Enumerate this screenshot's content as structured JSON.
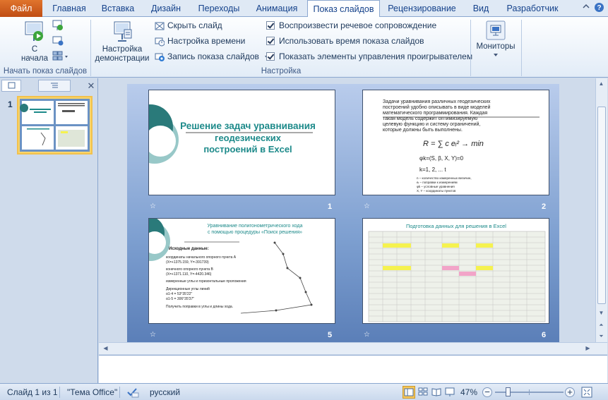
{
  "tabs": [
    "Файл",
    "Главная",
    "Вставка",
    "Дизайн",
    "Переходы",
    "Анимация",
    "Показ слайдов",
    "Рецензирование",
    "Вид",
    "Разработчик"
  ],
  "ribbon": {
    "group1": {
      "from_start_label_line1": "С",
      "from_start_label_line2": "начала",
      "group_name": "Начать показ слайдов"
    },
    "group2": {
      "setup_label_line1": "Настройка",
      "setup_label_line2": "демонстрации",
      "hide_slide": "Скрыть слайд",
      "rehearse_timings": "Настройка времени",
      "record_show": "Запись показа слайдов",
      "play_narrations": "Воспроизвести речевое сопровождение",
      "use_timings": "Использовать время показа слайдов",
      "show_media_controls": "Показать элементы управления проигрывателем",
      "group_name": "Настройка"
    },
    "group3": {
      "monitors_label": "Мониторы"
    }
  },
  "left_pane": {
    "thumbnail_number": "1"
  },
  "slides": [
    {
      "number": "1",
      "title_line1": "Решение задач уравнивания",
      "title_line2": "геодезических",
      "title_line3": "построений в Excel"
    },
    {
      "number": "2",
      "text_line1": "Задачи уравнивания различных геодезических",
      "text_line2": "построений удобно описывать в виде моделей",
      "text_line3": "математического программирования. Каждая",
      "text_line4": "такая модель содержит оптимизируемую",
      "text_line5": "целевую функцию и систему ограничений,",
      "text_line6": "которые должны быть выполнены.",
      "formula1": "R = ∑ c eᵢ² → min",
      "formula2": "φk=(S, β, X, Y)=0",
      "formula3": "k=1, 2, ... t",
      "legend_line1": "n – количество измеренных величин,",
      "legend_line2": "eᵢ – поправки к измерениям",
      "legend_line3": "φk – условные уравнения",
      "legend_line4": "X, Y – координаты пунктов"
    },
    {
      "number": "5",
      "title_line1": "Уравнивание полигонометрического хода",
      "title_line2": "с помощью процедуры «Поиск решения»",
      "subtitle": "Исходные данные:",
      "bullet1": "координаты начального опорного пункта А",
      "bullet2": "(X=+1375.159, Y=-391739)",
      "bullet3": "конечного опорного пункта B",
      "bullet4": "(X=+1371.110, Y=-4420.346)",
      "bullet5": "измеренные углы и горизонтальные проложения",
      "bullet6": "Дирекционные углы линий",
      "bullet7": "α1-4 = 53°35'22\"",
      "bullet8": "α1-5 = 306°35'37\"",
      "bullet9": "Получить поправки в углы и длины хода."
    },
    {
      "number": "6",
      "title": "Подготовка данных для решения в Excel"
    }
  ],
  "status_bar": {
    "slide_info": "Слайд 1 из 1",
    "theme": "\"Тема Office\"",
    "language": "русский",
    "zoom": "47%"
  },
  "colors": {
    "file_tab": "#c8541c",
    "ribbon_bg": "#e2ecf7",
    "slide_title": "#1d8a8a",
    "sorter_bg": "#7d9fd0"
  }
}
